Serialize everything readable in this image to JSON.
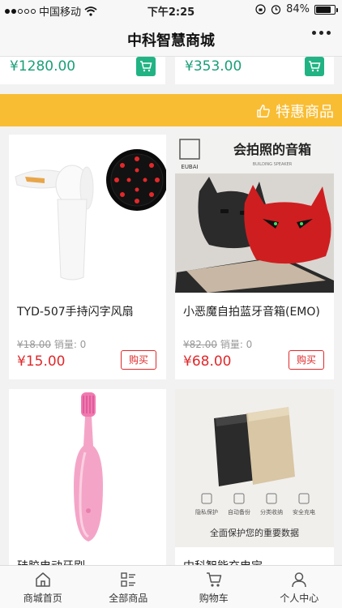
{
  "status_bar": {
    "carrier": "中国移动",
    "time": "下午2:25",
    "battery": "84%",
    "battery_level": 0.84
  },
  "header": {
    "title": "中科智慧商城"
  },
  "previous_row": {
    "left_price": "¥1280.00",
    "right_price": "¥353.00"
  },
  "section": {
    "title": "特惠商品"
  },
  "products": [
    {
      "name": "TYD-507手持闪字风扇",
      "old_price": "¥18.00",
      "sales": "销量: 0",
      "price": "¥15.00",
      "buy_label": "购买"
    },
    {
      "name": "小恶魔自拍蓝牙音箱(EMO)",
      "old_price": "¥82.00",
      "sales": "销量: 0",
      "price": "¥68.00",
      "buy_label": "购买",
      "image_text": {
        "brand": "EUBAI",
        "headline": "会拍照的音箱",
        "tagline": "BUILDING SPEAKER"
      }
    },
    {
      "name": "硅胶电动牙刷"
    },
    {
      "name": "中科智能充电宝",
      "image_text": {
        "features": [
          "隐私保护",
          "自动备份",
          "分类收纳",
          "安全充电"
        ],
        "caption": "全面保护您的重要数据"
      }
    }
  ],
  "tabbar": {
    "items": [
      {
        "label": "商城首页",
        "icon": "home-icon"
      },
      {
        "label": "全部商品",
        "icon": "list-icon"
      },
      {
        "label": "购物车",
        "icon": "cart-icon"
      },
      {
        "label": "个人中心",
        "icon": "user-icon"
      }
    ]
  },
  "colors": {
    "accent_green": "#21b383",
    "price_red": "#e0292b",
    "banner_yellow": "#f9bd33"
  }
}
